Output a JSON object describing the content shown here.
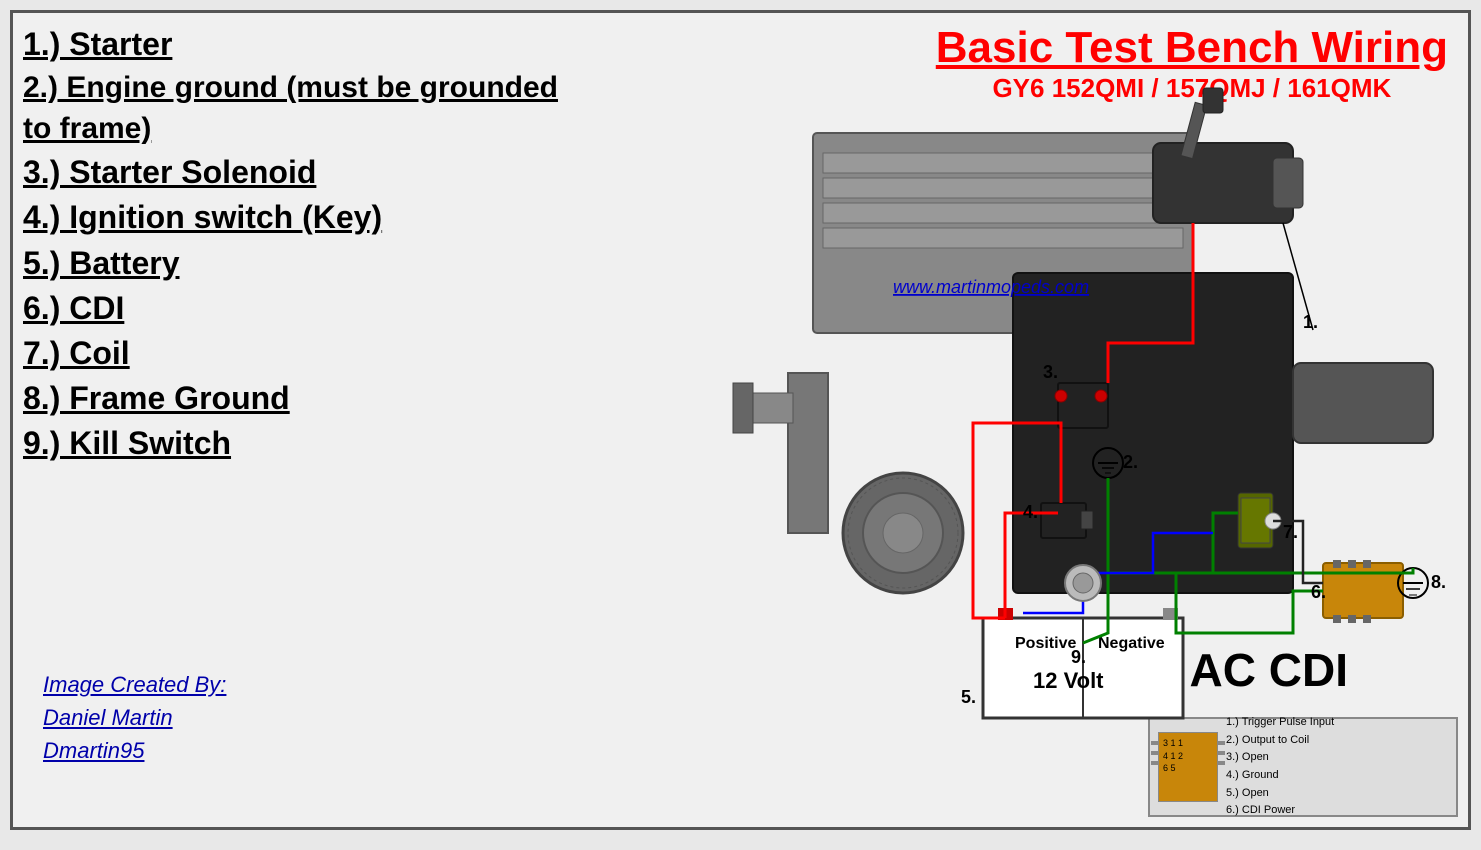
{
  "title": {
    "main": "Basic Test Bench Wiring",
    "sub": "GY6  152QMI / 157QMJ / 161QMK"
  },
  "numbered_list": [
    "1.)  Starter",
    "2.)  Engine ground (must be grounded to frame)",
    "3.)  Starter Solenoid",
    "4.)  Ignition switch (Key)",
    "5.)  Battery",
    "6.)  CDI",
    "7.)  Coil",
    "8.)  Frame Ground",
    "9.)  Kill Switch"
  ],
  "credit": {
    "line1": "Image Created By:",
    "line2": "Daniel Martin",
    "line3": "Dmartin95"
  },
  "website": "www.martinmopeds.com",
  "battery": {
    "positive": "Positive",
    "negative": "Negative",
    "voltage": "12 Volt"
  },
  "ac_cdi_label": "AC CDI",
  "cdi_legend": {
    "pin1": "1.) Trigger Pulse Input",
    "pin2": "2.) Output to Coil",
    "pin3": "3.) Open",
    "pin4": "4.) Ground",
    "pin5": "5.) Open",
    "pin6": "6.) CDI Power"
  },
  "labels": {
    "label_1": "1.",
    "label_2": "2.",
    "label_3": "3.",
    "label_4": "4.",
    "label_5": "5.",
    "label_6": "6.",
    "label_7": "7.",
    "label_8": "8.",
    "label_9": "9."
  }
}
